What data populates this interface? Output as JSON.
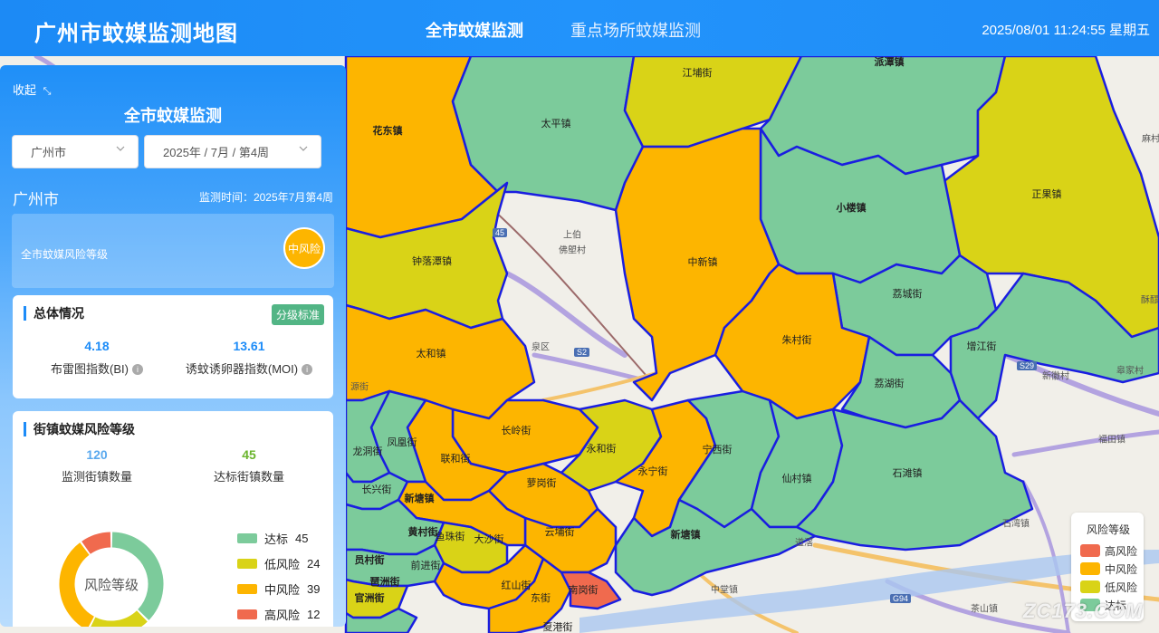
{
  "header": {
    "title": "广州市蚊媒监测地图",
    "tabs": [
      {
        "label": "全市蚊媒监测",
        "active": true
      },
      {
        "label": "重点场所蚊媒监测",
        "active": false
      }
    ],
    "datetime": "2025/08/01 11:24:55 星期五"
  },
  "panel": {
    "collapse_label": "收起",
    "title": "全市蚊媒监测",
    "city_select": "广州市",
    "period_select": "2025年 / 7月 / 第4周",
    "city_name": "广州市",
    "monitor_time": "监测时间：2025年7月第4周",
    "risk_level_label": "全市蚊媒风险等级",
    "risk_level_value": "中风险",
    "overall": {
      "title": "总体情况",
      "standard_button": "分级标准",
      "bi_value": "4.18",
      "bi_label": "布雷图指数(BI)",
      "moi_value": "13.61",
      "moi_label": "诱蚊诱卵器指数(MOI)"
    },
    "street_risk": {
      "title": "街镇蚊媒风险等级",
      "monitored_value": "120",
      "monitored_label": "监测街镇数量",
      "compliant_value": "45",
      "compliant_label": "达标街镇数量",
      "donut_center": "风险等级",
      "levels": [
        {
          "label": "达标",
          "count": "45",
          "color": "#7ccb9b"
        },
        {
          "label": "低风险",
          "count": "24",
          "color": "#d9d317"
        },
        {
          "label": "中风险",
          "count": "39",
          "color": "#fdb500"
        },
        {
          "label": "高风险",
          "count": "12",
          "color": "#f06a4e"
        }
      ]
    }
  },
  "map": {
    "colors": {
      "compliant": "#7ccb9b",
      "low": "#d9d317",
      "medium": "#fdb500",
      "high": "#f06a4e",
      "border": "#1a1ee0"
    },
    "region_labels": [
      "江埔街",
      "派潭镇",
      "太平镇",
      "花东镇",
      "小楼镇",
      "正果镇",
      "钟落潭镇",
      "中新镇",
      "荔城街",
      "朱村街",
      "太和镇",
      "增江街",
      "荔湖街",
      "长岭街",
      "永和街",
      "凤凰街",
      "联和街",
      "宁西街",
      "龙洞街",
      "永宁街",
      "仙村镇",
      "石滩镇",
      "长兴街",
      "新塘镇",
      "萝岗街",
      "云埔街",
      "新塘镇",
      "黄村街",
      "大沙街",
      "南岗街",
      "东街",
      "夏港街",
      "员村街",
      "琶洲街",
      "官洲街",
      "前进街",
      "鱼珠街",
      "红山街"
    ],
    "base_labels": [
      "上伯",
      "佛塱村",
      "麻村",
      "新徽村",
      "皋家村",
      "福田镇",
      "石湾镇",
      "中堂镇",
      "茶山镇",
      "道滘",
      "源街",
      "泉区",
      "酥醪"
    ],
    "shields": [
      "45",
      "S2",
      "S29",
      "G94"
    ],
    "legend_title": "风险等级",
    "legend": [
      {
        "label": "高风险",
        "color": "#f06a4e"
      },
      {
        "label": "中风险",
        "color": "#fdb500"
      },
      {
        "label": "低风险",
        "color": "#d9d317"
      },
      {
        "label": "达标",
        "color": "#7ccb9b"
      }
    ]
  },
  "watermark": "ZC173.COM"
}
